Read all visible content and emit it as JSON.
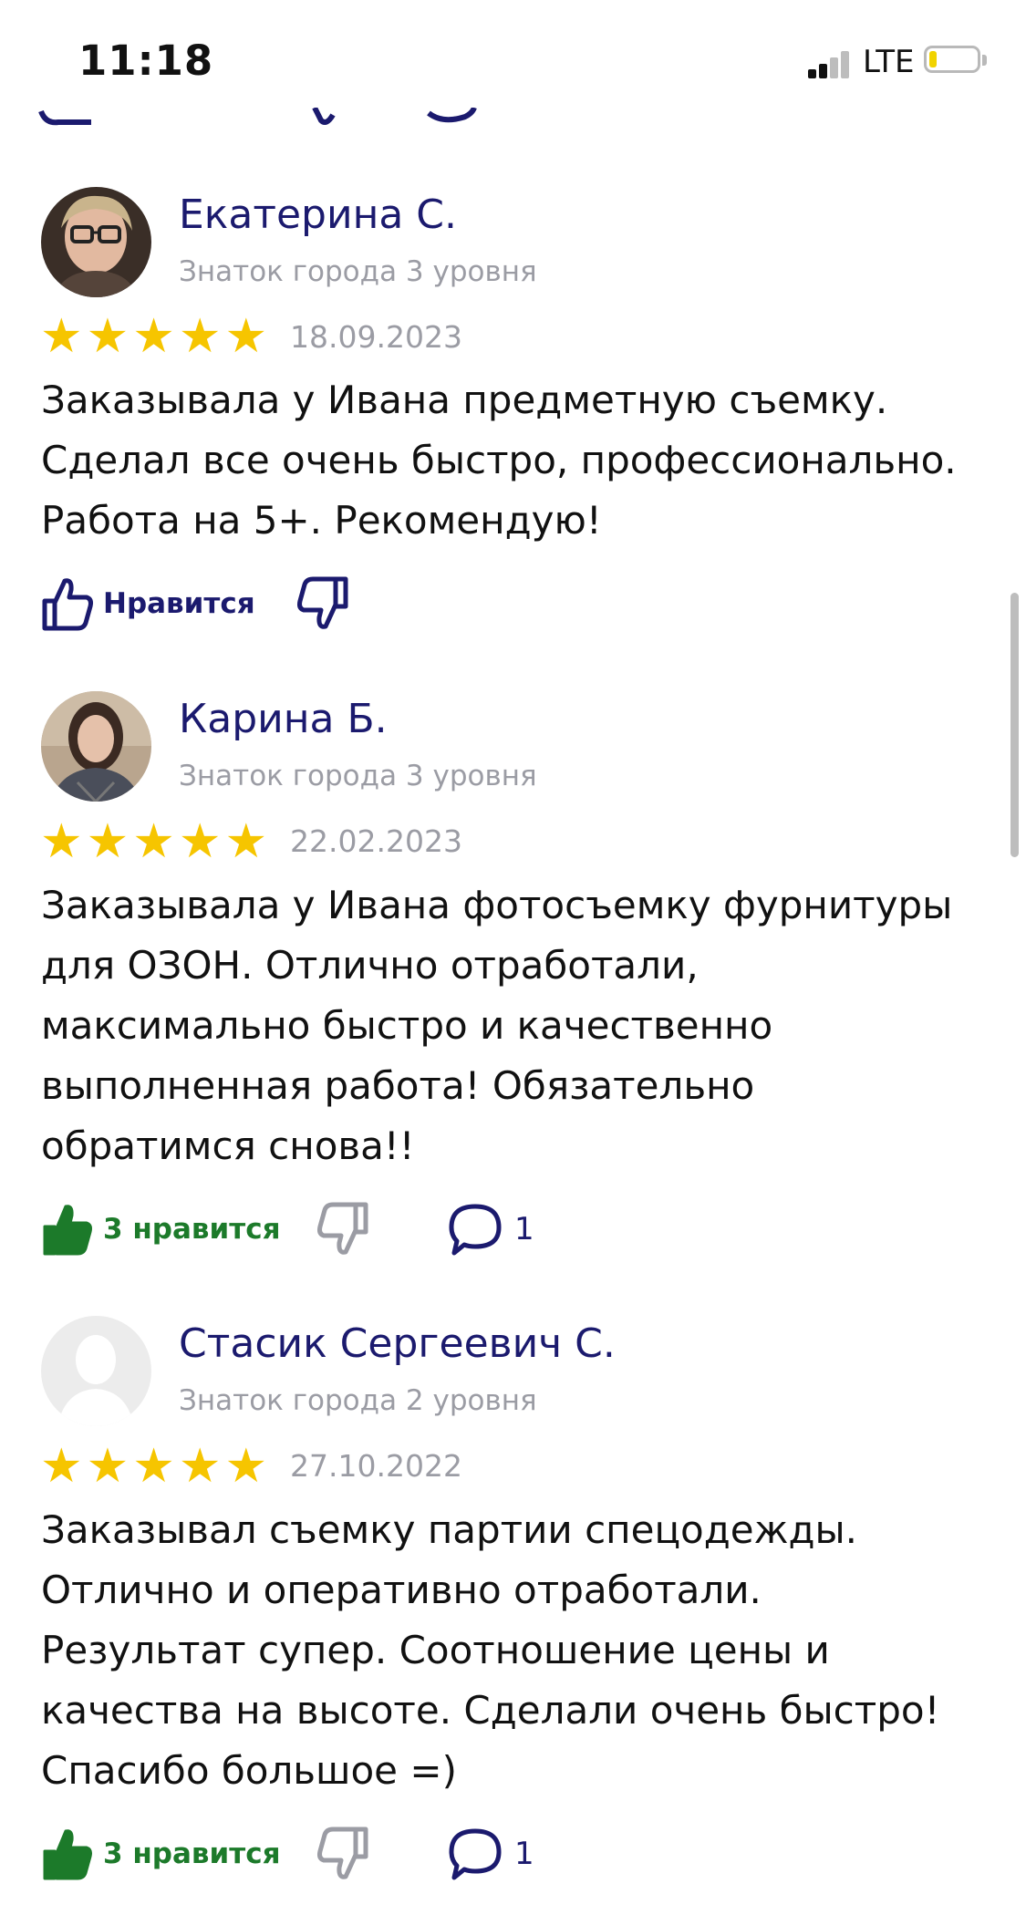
{
  "status_bar": {
    "time": "11:18",
    "network": "LTE",
    "battery_level": 0.1
  },
  "reviews": [
    {
      "author": "Екатерина С.",
      "level": "Знаток города 3 уровня",
      "rating": 5,
      "date": "18.09.2023",
      "text_lines": [
        "Заказывала у Ивана предметную съемку.",
        "Сделал все очень быстро, профессионально.",
        "Работа на 5+. Рекомендую!"
      ],
      "like_label": "Нравится"
    },
    {
      "author": "Карина Б.",
      "level": "Знаток города 3 уровня",
      "rating": 5,
      "date": "22.02.2023",
      "text_lines": [
        "Заказывала у Ивана фотосъемку фурнитуры",
        "для ОЗОН. Отлично отработали,",
        "максимально быстро и качественно",
        "выполненная работа! Обязательно",
        "обратимся снова!!"
      ],
      "like_label": "3 нравится",
      "comment_count": "1"
    },
    {
      "author": "Стасик Сергеевич С.",
      "level": "Знаток города 2 уровня",
      "rating": 5,
      "date": "27.10.2022",
      "text_lines": [
        "Заказывал съемку партии спецодежды.",
        "Отлично и оперативно отработали.",
        "Результат супер. Соотношение цены и",
        "качества на высоте. Сделали очень быстро!",
        "Спасибо большое =)"
      ],
      "like_label": "3 нравится",
      "comment_count": "1"
    }
  ],
  "colors": {
    "author": "#1b1a6e",
    "muted": "#9b9ca4",
    "star": "#f6c500",
    "liked": "#1c7a2a"
  }
}
